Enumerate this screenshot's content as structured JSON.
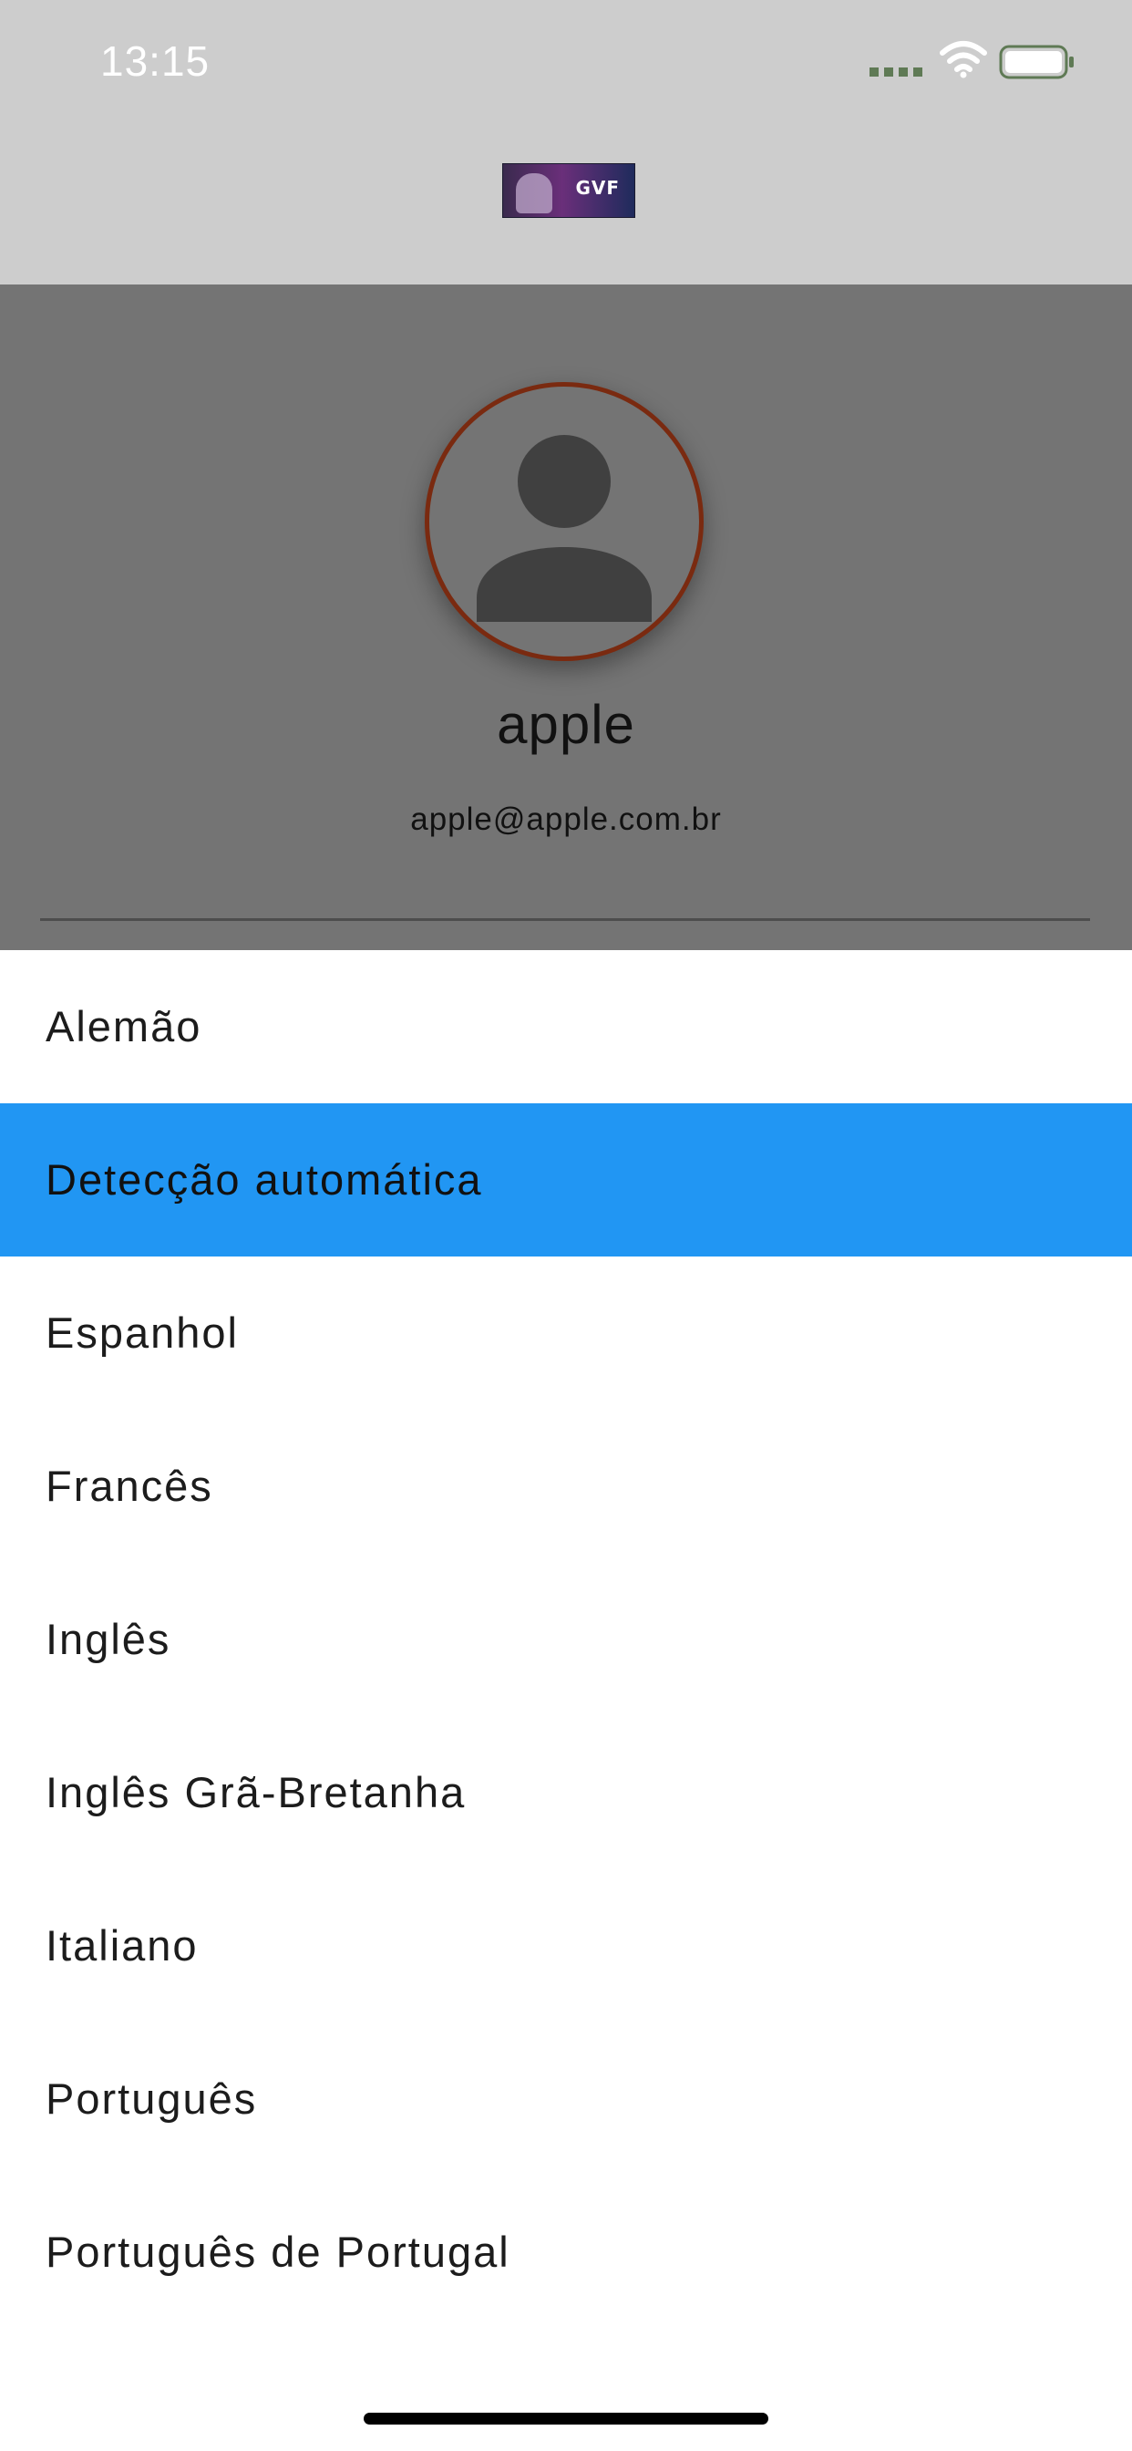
{
  "status_bar": {
    "time": "13:15",
    "signal_icon": "cellular-signal-icon",
    "wifi_icon": "wifi-icon",
    "battery_icon": "battery-icon"
  },
  "app_bar": {
    "logo_text": "GVF",
    "logo_icon": "app-logo"
  },
  "profile": {
    "avatar_icon": "person-silhouette-icon",
    "name": "apple",
    "email": "apple@apple.com.br"
  },
  "language_sheet": {
    "options": [
      {
        "label": "Alemão",
        "selected": false
      },
      {
        "label": "Detecção automática",
        "selected": true
      },
      {
        "label": "Espanhol",
        "selected": false
      },
      {
        "label": "Francês",
        "selected": false
      },
      {
        "label": "Inglês",
        "selected": false
      },
      {
        "label": "Inglês Grã-Bretanha",
        "selected": false
      },
      {
        "label": "Italiano",
        "selected": false
      },
      {
        "label": "Português",
        "selected": false
      },
      {
        "label": "Português de Portugal",
        "selected": false
      }
    ]
  },
  "colors": {
    "selected_row": "#2196f3",
    "avatar_border": "#7a2a10",
    "scrim": "#747474",
    "app_bar": "#cdcdcd"
  }
}
